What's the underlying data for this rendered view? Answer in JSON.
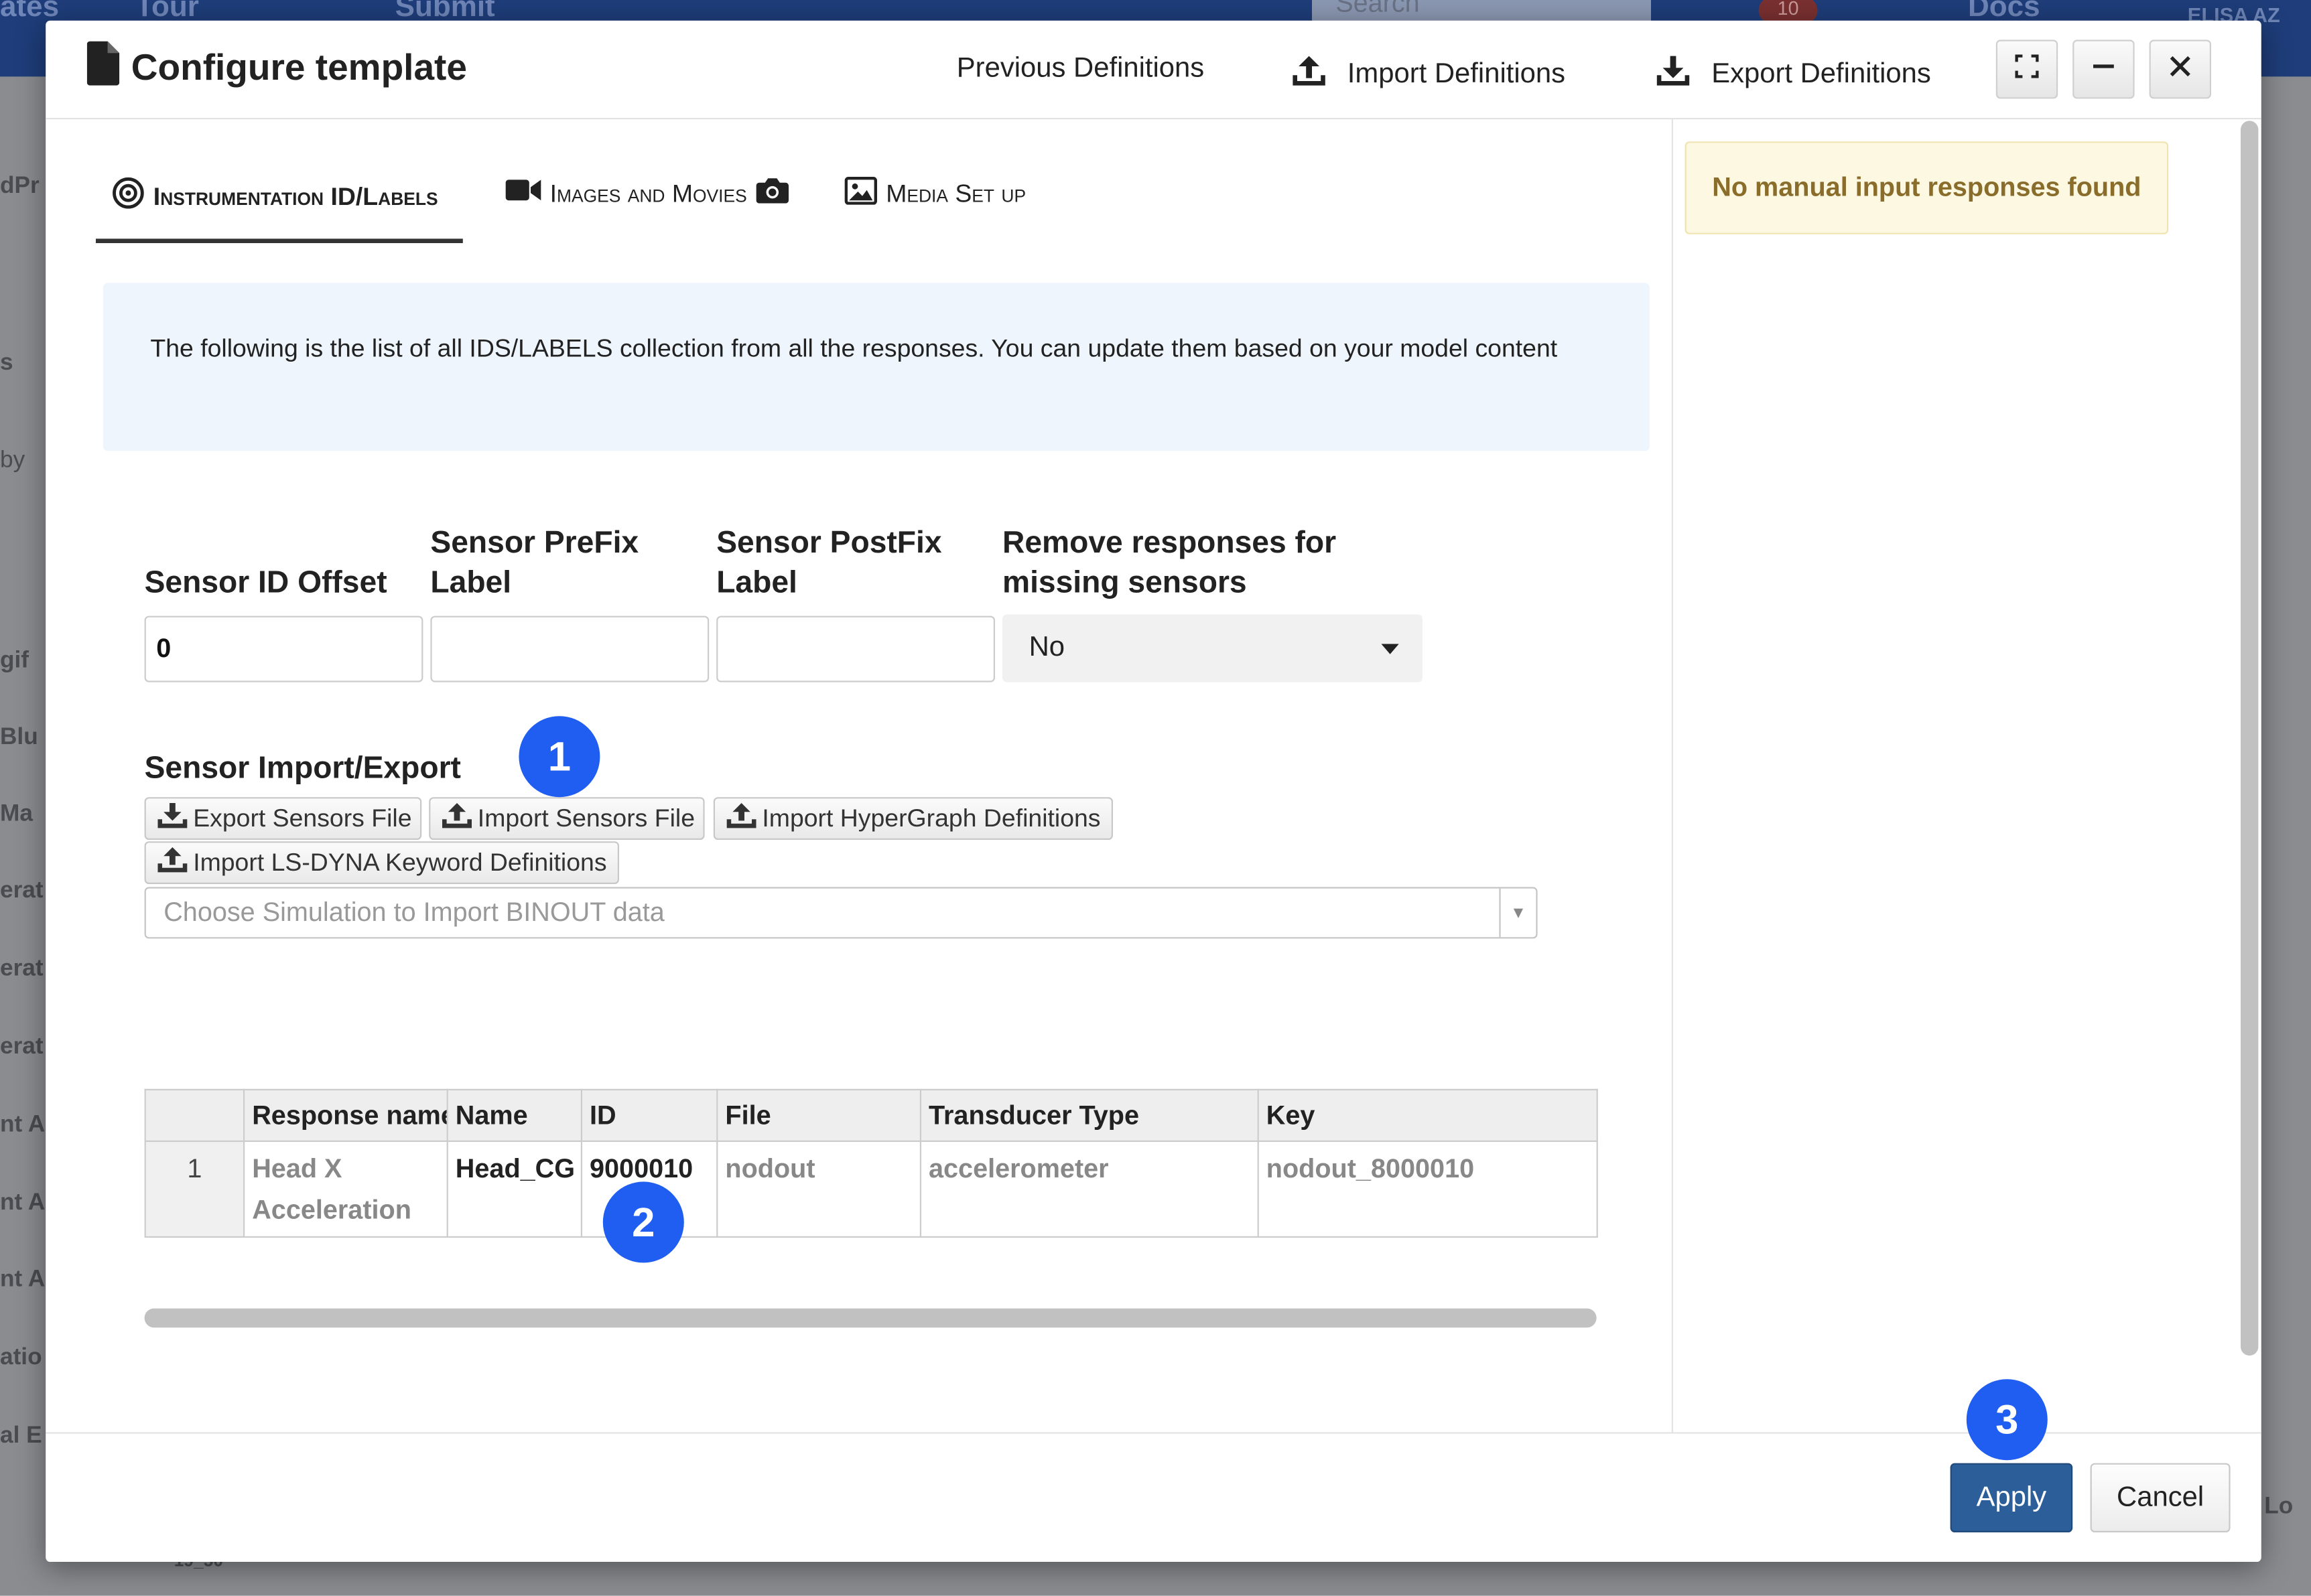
{
  "background": {
    "top_fragments": [
      "ates",
      "Tour",
      "Submit",
      "Search",
      "10",
      "Docs",
      "ELISA AZ"
    ],
    "left_fragments": [
      "dPr",
      "s",
      "by",
      "gif",
      "Blu",
      "Ma",
      "erat",
      "erat",
      "erat",
      "nt A",
      "nt A",
      "nt A",
      "atio",
      "al E"
    ],
    "bottom_fragments": [
      "19_50",
      "Lo"
    ]
  },
  "dialog": {
    "title": "Configure template",
    "header_links": {
      "previous": "Previous Definitions",
      "import": "Import Definitions",
      "export": "Export Definitions"
    }
  },
  "tabs": [
    {
      "label": "Instrumentation ID/Labels",
      "icon": "target-icon"
    },
    {
      "label": "Images and Movies",
      "icon": "video-camera-icon"
    },
    {
      "label": "Media Set up",
      "icon": "image-icon"
    }
  ],
  "info_text": "The following is the list of all IDS/LABELS collection from all the responses. You can update them based on your model content",
  "fields": {
    "offset_label": "Sensor ID Offset",
    "offset_value": "0",
    "prefix_label_1": "Sensor PreFix",
    "prefix_label_2": "Label",
    "prefix_value": "",
    "postfix_label_1": "Sensor PostFix",
    "postfix_label_2": "Label",
    "postfix_value": "",
    "remove_label_1": "Remove responses for",
    "remove_label_2": "missing sensors",
    "remove_value": "No"
  },
  "import_export": {
    "title": "Sensor Import/Export",
    "buttons": {
      "export_sensors": "Export Sensors File",
      "import_sensors": "Import Sensors File",
      "import_hypergraph": "Import HyperGraph Definitions",
      "import_lsdyna": "Import LS-DYNA Keyword Definitions"
    },
    "binout_placeholder": "Choose Simulation to Import BINOUT data"
  },
  "table": {
    "columns": [
      "",
      "Response name",
      "Name",
      "ID",
      "File",
      "Transducer Type",
      "Key"
    ],
    "rows": [
      {
        "num": "1",
        "response_line1": "Head X",
        "response_line2": "Acceleration",
        "name": "Head_CG",
        "id": "9000010",
        "file": "nodout",
        "type": "accelerometer",
        "key": "nodout_8000010"
      }
    ]
  },
  "sidebar": {
    "alert": "No manual input responses found"
  },
  "footer": {
    "apply": "Apply",
    "cancel": "Cancel"
  },
  "markers": [
    "1",
    "2",
    "3"
  ],
  "colors": {
    "marker": "#1f5ef0",
    "apply": "#2c5e99",
    "alert_bg": "#fcf8e1",
    "alert_text": "#8a6d2b",
    "info_bg": "#eef5fc"
  }
}
